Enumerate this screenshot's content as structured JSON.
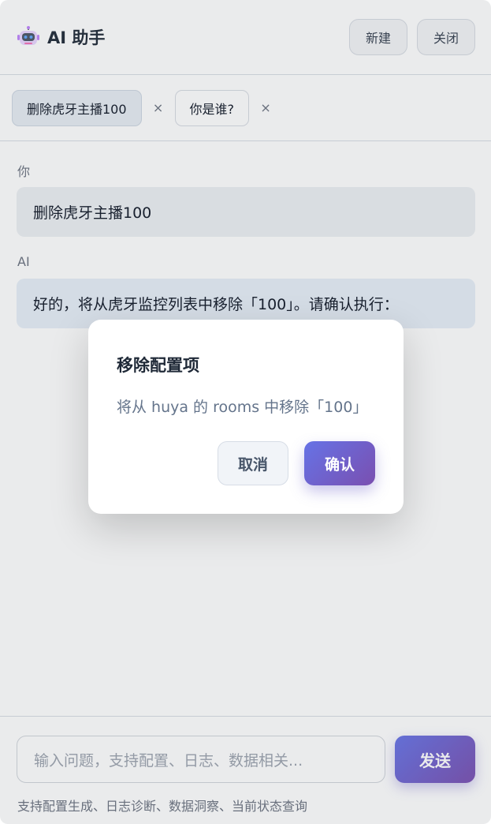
{
  "header": {
    "icon": "robot-icon",
    "title": "AI 助手",
    "new_label": "新建",
    "close_label": "关闭"
  },
  "tabs": [
    {
      "label": "删除虎牙主播100",
      "active": true
    },
    {
      "label": "你是谁?",
      "active": false
    }
  ],
  "tab_close_symbol": "×",
  "messages": [
    {
      "role": "你",
      "text": "删除虎牙主播100"
    },
    {
      "role": "AI",
      "text": "好的，将从虎牙监控列表中移除「100」。请确认执行："
    }
  ],
  "footer": {
    "placeholder": "输入问题，支持配置、日志、数据相关...",
    "send_label": "发送",
    "hint": "支持配置生成、日志诊断、数据洞察、当前状态查询"
  },
  "modal": {
    "title": "移除配置项",
    "message": "将从 huya 的 rooms 中移除「100」",
    "cancel_label": "取消",
    "confirm_label": "确认"
  },
  "colors": {
    "accent_start": "#6673e6",
    "accent_end": "#7a4fb0"
  }
}
